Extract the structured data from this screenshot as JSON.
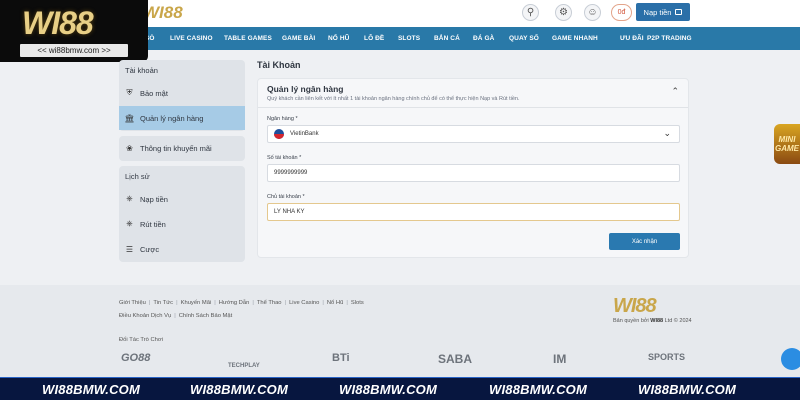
{
  "brand": {
    "logo_text": "WI88",
    "badge_url": "<< wi88bmw.com >>"
  },
  "header": {
    "balance": "0đ",
    "deposit_label": "Nạp tiền"
  },
  "nav": {
    "items": [
      {
        "label": "SÒ"
      },
      {
        "label": "LIVE CASINO"
      },
      {
        "label": "TABLE GAMES"
      },
      {
        "label": "GAME BÀI"
      },
      {
        "label": "NỔ HŨ"
      },
      {
        "label": "LÔ ĐỀ"
      },
      {
        "label": "SLOTS"
      },
      {
        "label": "BẮN CÁ"
      },
      {
        "label": "ĐÁ GÀ"
      },
      {
        "label": "QUAY SỐ"
      },
      {
        "label": "GAME NHANH"
      },
      {
        "label": "ƯU ĐÃI"
      },
      {
        "label": "P2P TRADING"
      }
    ]
  },
  "sidebar": {
    "account_heading": "Tài khoản",
    "account_items": [
      {
        "label": "Bảo mật",
        "icon": "shield-icon"
      },
      {
        "label": "Quản lý ngân hàng",
        "icon": "bank-icon"
      }
    ],
    "promo_item": {
      "label": "Thông tin khuyến mãi",
      "icon": "gift-icon"
    },
    "history_heading": "Lịch sử",
    "history_items": [
      {
        "label": "Nạp tiền",
        "icon": "deposit-icon"
      },
      {
        "label": "Rút tiền",
        "icon": "withdraw-icon"
      },
      {
        "label": "Cược",
        "icon": "bet-icon"
      }
    ]
  },
  "main": {
    "page_title": "Tài Khoản",
    "panel_title": "Quản lý ngân hàng",
    "panel_subtitle": "Quý khách cần liên kết với ít nhất 1 tài khoản ngân hàng chính chủ để có thể thực hiện Nạp và Rút tiền.",
    "bank_label": "Ngân hàng *",
    "bank_value": "VietinBank",
    "account_number_label": "Số tài khoản *",
    "account_number_value": "9999999999",
    "account_holder_label": "Chủ tài khoản *",
    "account_holder_value": "LY NHA KY",
    "confirm_label": "Xác nhận"
  },
  "footer": {
    "links_row1": [
      "Giới Thiệu",
      "Tin Tức",
      "Khuyến Mãi",
      "Hướng Dẫn",
      "Thể Thao",
      "Live Casino",
      "Nổ Hũ",
      "Slots"
    ],
    "links_row2": [
      "Điều Khoản Dịch Vụ",
      "Chính Sách Bảo Mật"
    ],
    "partners_label": "Đối Tác Trò Chơi",
    "partners": [
      "GO88",
      "TECHPLAY",
      "BTi",
      "SABA",
      "IM",
      "SPORTS"
    ],
    "copyright_prefix": "Bản quyền bởi",
    "copyright_brand": "WI88",
    "copyright_suffix": "Ltd © 2024"
  },
  "floating": {
    "mini_game": "MINI GAME"
  },
  "banner": {
    "items": [
      "WI88BMW.COM",
      "WI88BMW.COM",
      "WI88BMW.COM",
      "WI88BMW.COM",
      "WI88BMW.COM"
    ]
  }
}
